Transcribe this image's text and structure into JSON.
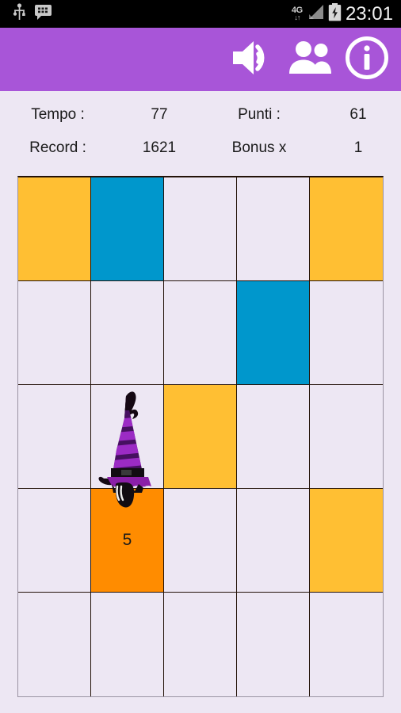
{
  "statusbar": {
    "icons": [
      "usb-icon",
      "messenger-icon"
    ],
    "network_label": "4G",
    "network_arrows": "↓↑",
    "signal_icon": "signal-bars-icon",
    "battery_icon": "battery-charging-icon",
    "clock": "23:01"
  },
  "appbar": {
    "background": "#A855D8",
    "buttons": [
      {
        "name": "sound-button",
        "icon": "speaker-volume-icon"
      },
      {
        "name": "multiplayer-button",
        "icon": "people-group-icon"
      },
      {
        "name": "info-button",
        "icon": "info-circle-icon"
      }
    ]
  },
  "stats": {
    "tempo_label": "Tempo :",
    "tempo_value": "77",
    "punti_label": "Punti :",
    "punti_value": "61",
    "record_label": "Record :",
    "record_value": "1621",
    "bonus_label": "Bonus x",
    "bonus_value": "1"
  },
  "board": {
    "rows": 5,
    "cols": 5,
    "colors": {
      "empty": "#EDE7F3",
      "amber": "#FFBF33",
      "blue": "#0097CC",
      "orange": "#FF8C00",
      "gridline": "#231208"
    },
    "cells": [
      {
        "state": "amber",
        "label": ""
      },
      {
        "state": "blue",
        "label": ""
      },
      {
        "state": "empty",
        "label": ""
      },
      {
        "state": "empty",
        "label": ""
      },
      {
        "state": "amber",
        "label": ""
      },
      {
        "state": "empty",
        "label": ""
      },
      {
        "state": "empty",
        "label": ""
      },
      {
        "state": "empty",
        "label": ""
      },
      {
        "state": "blue",
        "label": ""
      },
      {
        "state": "empty",
        "label": ""
      },
      {
        "state": "empty",
        "label": ""
      },
      {
        "state": "empty",
        "label": ""
      },
      {
        "state": "amber",
        "label": ""
      },
      {
        "state": "empty",
        "label": ""
      },
      {
        "state": "empty",
        "label": ""
      },
      {
        "state": "empty",
        "label": ""
      },
      {
        "state": "orange",
        "label": "5"
      },
      {
        "state": "empty",
        "label": ""
      },
      {
        "state": "empty",
        "label": ""
      },
      {
        "state": "amber",
        "label": ""
      },
      {
        "state": "empty",
        "label": ""
      },
      {
        "state": "empty",
        "label": ""
      },
      {
        "state": "empty",
        "label": ""
      },
      {
        "state": "empty",
        "label": ""
      },
      {
        "state": "empty",
        "label": ""
      }
    ]
  },
  "player": {
    "sprite": "witch-sprite",
    "hat_color_light": "#9B2BC4",
    "hat_color_dark": "#461060",
    "body_color": "#120C12"
  }
}
